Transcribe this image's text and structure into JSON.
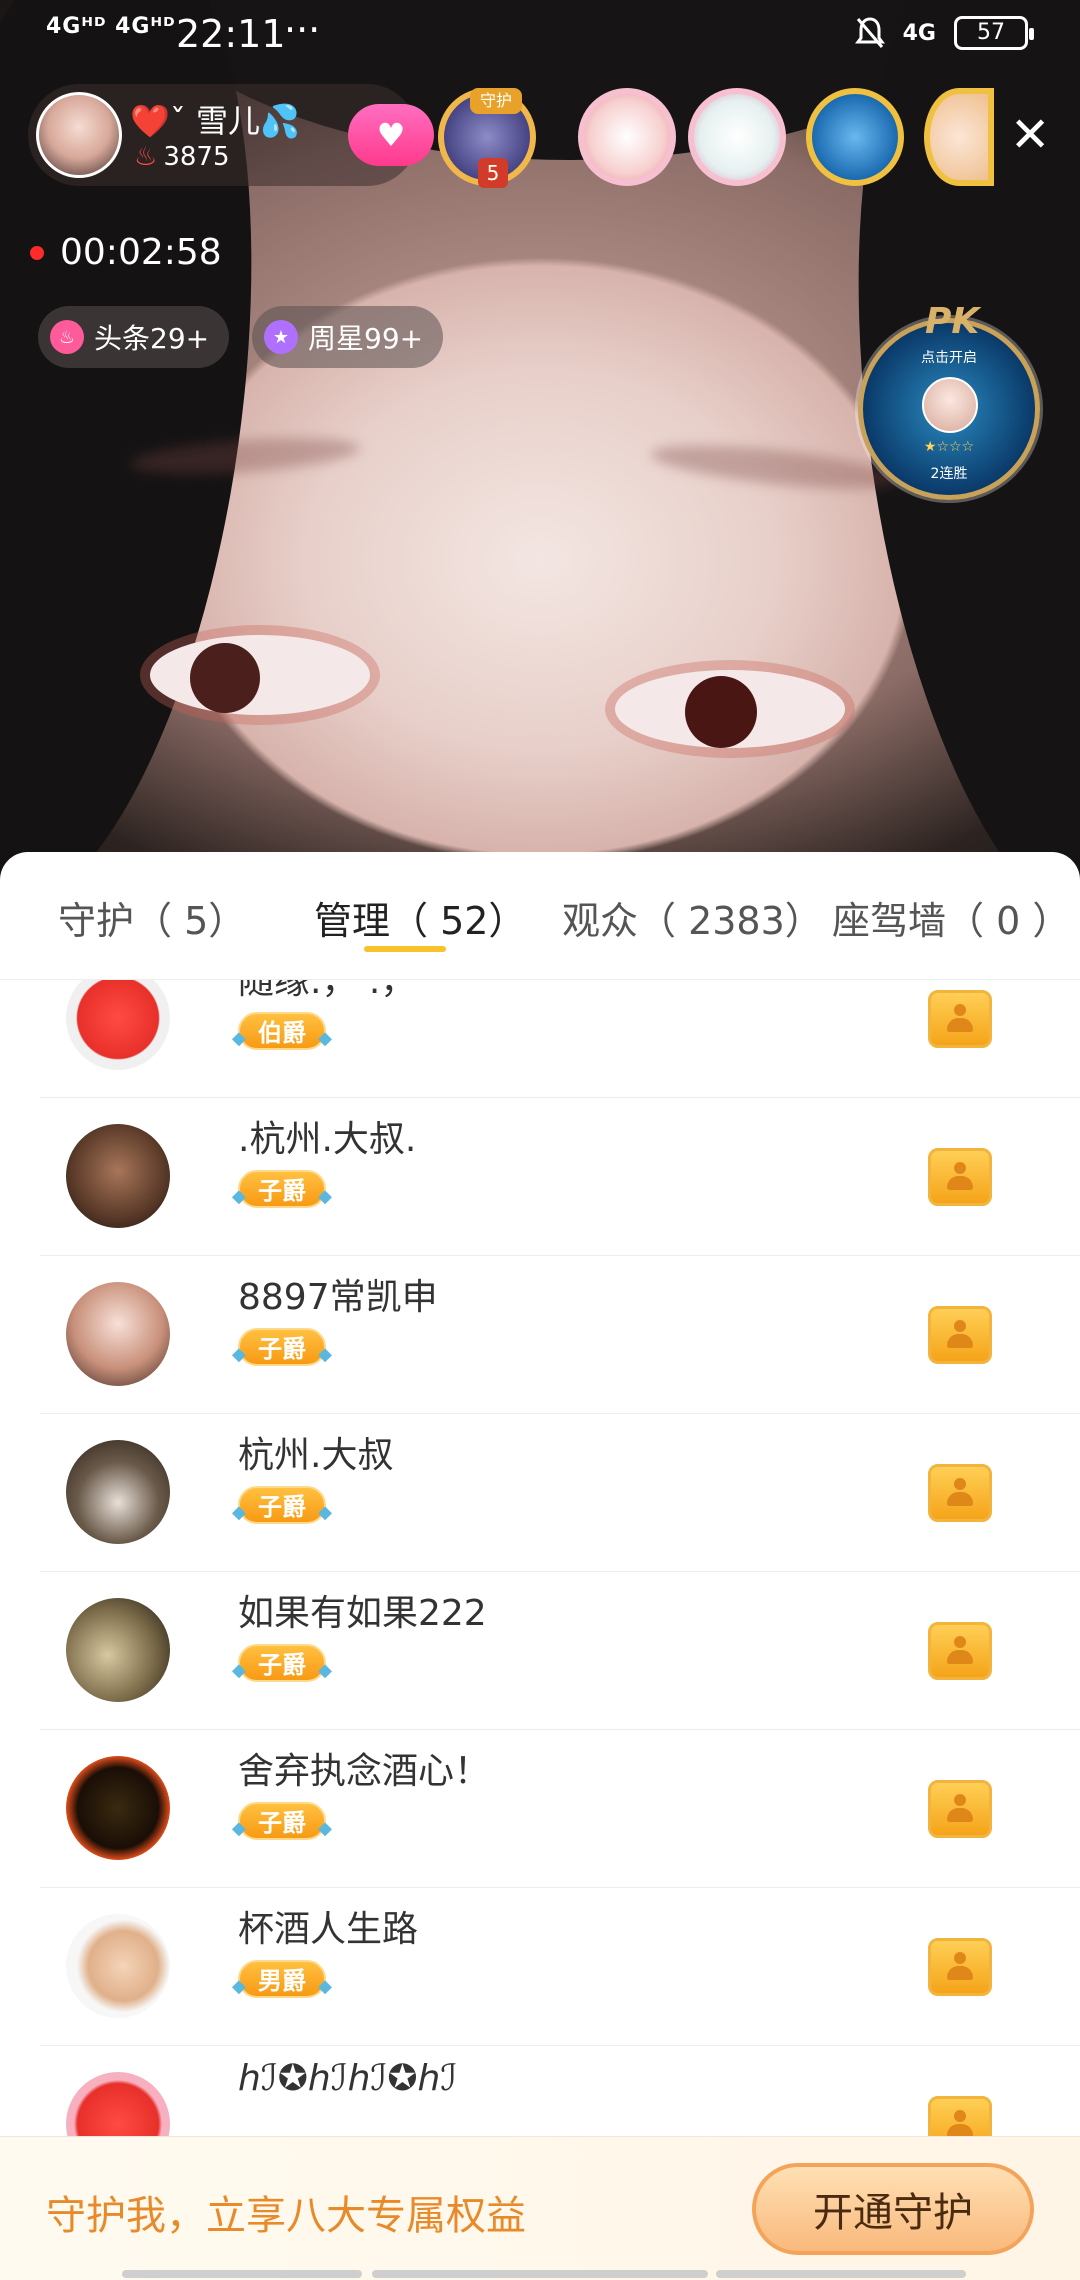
{
  "status_bar": {
    "signal": "4Gᴴᴰ 4Gᴴᴰ",
    "time": "22:11",
    "dots": "···",
    "network": "4G",
    "battery": "57"
  },
  "host": {
    "name": "❤️ˇ 雪儿💦",
    "heat": "3875",
    "follow_icon": "♥"
  },
  "guard_badge_label": "守护",
  "guard_badge_count": "5",
  "live": {
    "duration": "00:02:58"
  },
  "ranks": {
    "headline": "头条29+",
    "weekly_star": "周星99+"
  },
  "pk": {
    "logo": "PK",
    "hint": "点击开启",
    "stars": "★☆☆☆",
    "streak": "2连胜"
  },
  "tabs": [
    {
      "label": "守护（ 5）"
    },
    {
      "label": "管理（ 52）"
    },
    {
      "label": "观众（ 2383）"
    },
    {
      "label": "座驾墙（ 0 ）"
    }
  ],
  "members": [
    {
      "name": "随缘.， .，",
      "rank": "伯爵"
    },
    {
      "name": ".杭州.大叔.",
      "rank": "子爵"
    },
    {
      "name": "8897常凯申",
      "rank": "子爵"
    },
    {
      "name": "杭州.大叔",
      "rank": "子爵"
    },
    {
      "name": "如果有如果222",
      "rank": "子爵"
    },
    {
      "name": "舍弃执念酒心！",
      "rank": "子爵"
    },
    {
      "name": "杯酒人生路",
      "rank": "男爵"
    },
    {
      "name": "hℐ✪hℐhℐ✪hℐ",
      "rank": ""
    }
  ],
  "promo": {
    "text": "守护我，立享八大专属权益",
    "button": "开通守护"
  },
  "colors": {
    "accent": "#f7c22a",
    "promo_text": "#e98a2a",
    "rank_tag": "#f89a14"
  }
}
